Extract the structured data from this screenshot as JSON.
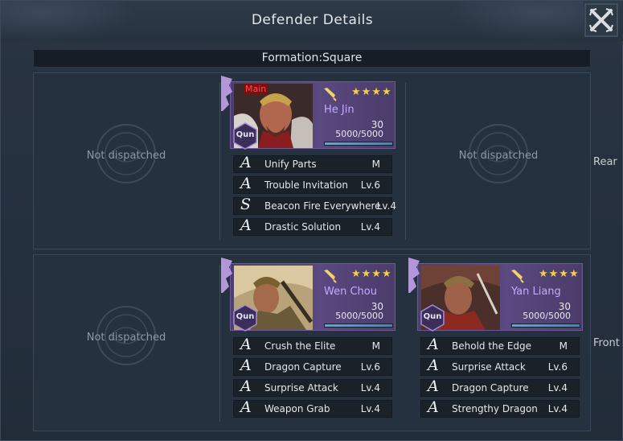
{
  "window": {
    "title": "Defender Details"
  },
  "formation": {
    "label": "Formation:Square"
  },
  "rows": {
    "rear": {
      "label": "Rear",
      "left_empty": "Not dispatched",
      "right_empty": "Not dispatched",
      "general": {
        "name": "He Jin",
        "tag": "Main",
        "faction": "Qun",
        "stars": "★★★★",
        "level": "30",
        "troops": "5000/5000",
        "troop_fraction": 1.0,
        "skills": [
          {
            "grade": "A",
            "name": "Unify Parts",
            "level": "M"
          },
          {
            "grade": "A",
            "name": "Trouble Invitation",
            "level": "Lv.6"
          },
          {
            "grade": "S",
            "name": "Beacon Fire Everywhere",
            "level": "Lv.4"
          },
          {
            "grade": "A",
            "name": "Drastic Solution",
            "level": "Lv.4"
          }
        ]
      }
    },
    "front": {
      "label": "Front",
      "left_empty": "Not dispatched",
      "middle": {
        "name": "Wen Chou",
        "faction": "Qun",
        "stars": "★★★★",
        "level": "30",
        "troops": "5000/5000",
        "troop_fraction": 1.0,
        "skills": [
          {
            "grade": "A",
            "name": "Crush the Elite",
            "level": "M"
          },
          {
            "grade": "A",
            "name": "Dragon Capture",
            "level": "Lv.6"
          },
          {
            "grade": "A",
            "name": "Surprise Attack",
            "level": "Lv.4"
          },
          {
            "grade": "A",
            "name": "Weapon Grab",
            "level": "Lv.4"
          }
        ]
      },
      "right": {
        "name": "Yan Liang",
        "faction": "Qun",
        "stars": "★★★★",
        "level": "30",
        "troops": "5000/5000",
        "troop_fraction": 1.0,
        "skills": [
          {
            "grade": "A",
            "name": "Behold the Edge",
            "level": "M"
          },
          {
            "grade": "A",
            "name": "Surprise Attack",
            "level": "Lv.6"
          },
          {
            "grade": "A",
            "name": "Dragon Capture",
            "level": "Lv.4"
          },
          {
            "grade": "A",
            "name": "Strengthy Dragon",
            "level": "Lv.4"
          }
        ]
      }
    }
  },
  "icons": {
    "close": "close-icon",
    "faction_badge": "faction-hexagon-icon",
    "quill": "quill-icon",
    "pennant": "pennant-icon",
    "emblem": "emblem-icon"
  },
  "colors": {
    "card_purple": "#5a4880",
    "name_purple": "#c8a8ff",
    "star_gold": "#f4cf4a",
    "troop_blue": "#5aa8e8"
  }
}
